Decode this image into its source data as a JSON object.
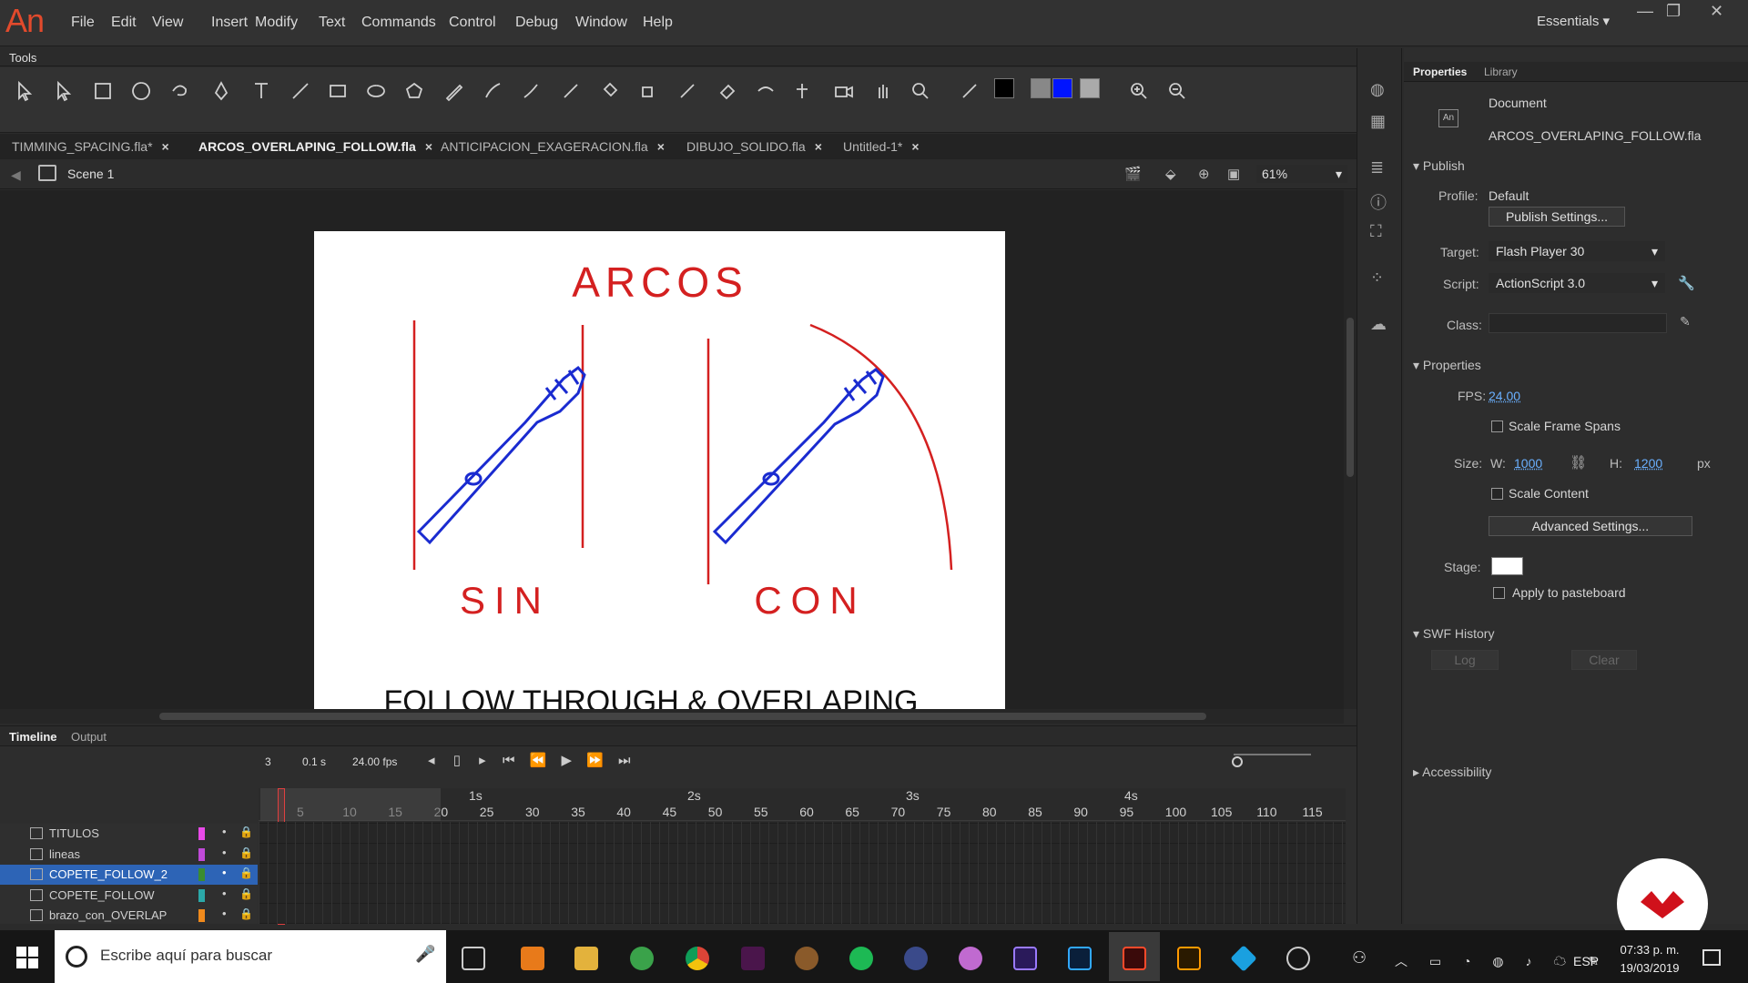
{
  "app": {
    "logo": "An",
    "workspace": "Essentials"
  },
  "menu": [
    "File",
    "Edit",
    "View",
    "Insert",
    "Modify",
    "Text",
    "Commands",
    "Control",
    "Debug",
    "Window",
    "Help"
  ],
  "tools_title": "Tools",
  "tabs": [
    {
      "label": "TIMMING_SPACING.fla*"
    },
    {
      "label": "ARCOS_OVERLAPING_FOLLOW.fla"
    },
    {
      "label": "ANTICIPACION_EXAGERACION.fla"
    },
    {
      "label": "DIBUJO_SOLIDO.fla"
    },
    {
      "label": "Untitled-1*"
    }
  ],
  "tab_close": "×",
  "scene": {
    "label": "Scene 1",
    "zoom": "61%"
  },
  "stage_text": {
    "title": "ARCOS",
    "left_label": "SIN",
    "right_label": "CON",
    "bottom": "FOLLOW THROUGH & OVERLAPING"
  },
  "timeline": {
    "tab": "Timeline",
    "output": "Output",
    "frame": "3",
    "time": "0.1 s",
    "fps": "24.00 fps",
    "seconds": [
      "1s",
      "2s",
      "3s",
      "4s"
    ],
    "ruler": [
      "5",
      "10",
      "15",
      "20",
      "25",
      "30",
      "35",
      "40",
      "45",
      "50",
      "55",
      "60",
      "65",
      "70",
      "75",
      "80",
      "85",
      "90",
      "95",
      "100",
      "105",
      "110",
      "115"
    ],
    "layers": [
      {
        "name": "TITULOS",
        "color": "#e84ae8"
      },
      {
        "name": "lineas",
        "color": "#c04ad8"
      },
      {
        "name": "COPETE_FOLLOW_2",
        "color": "#3b8c2f"
      },
      {
        "name": "COPETE_FOLLOW",
        "color": "#2ba8a8"
      },
      {
        "name": "brazo_con_OVERLAP",
        "color": "#f08a1c"
      }
    ]
  },
  "properties": {
    "tab": "Properties",
    "library": "Library",
    "doc_type": "Document",
    "doc_name": "ARCOS_OVERLAPING_FOLLOW.fla",
    "publish": "Publish",
    "profile_label": "Profile:",
    "profile": "Default",
    "publish_settings": "Publish Settings...",
    "target_label": "Target:",
    "target": "Flash Player 30",
    "script_label": "Script:",
    "script": "ActionScript 3.0",
    "class_label": "Class:",
    "props_section": "Properties",
    "fps_label": "FPS:",
    "fps": "24.00",
    "scale_spans": "Scale Frame Spans",
    "size_label": "Size:",
    "w_label": "W:",
    "w": "1000",
    "h_label": "H:",
    "h": "1200",
    "px": "px",
    "scale_content": "Scale Content",
    "advanced": "Advanced Settings...",
    "stage_label": "Stage:",
    "apply": "Apply to pasteboard",
    "swf_history": "SWF History",
    "log": "Log",
    "clear": "Clear",
    "accessibility": "Accessibility"
  },
  "taskbar": {
    "search_placeholder": "Escribe aquí para buscar",
    "lang": "ESP",
    "time": "07:33 p. m.",
    "date": "19/03/2019"
  }
}
